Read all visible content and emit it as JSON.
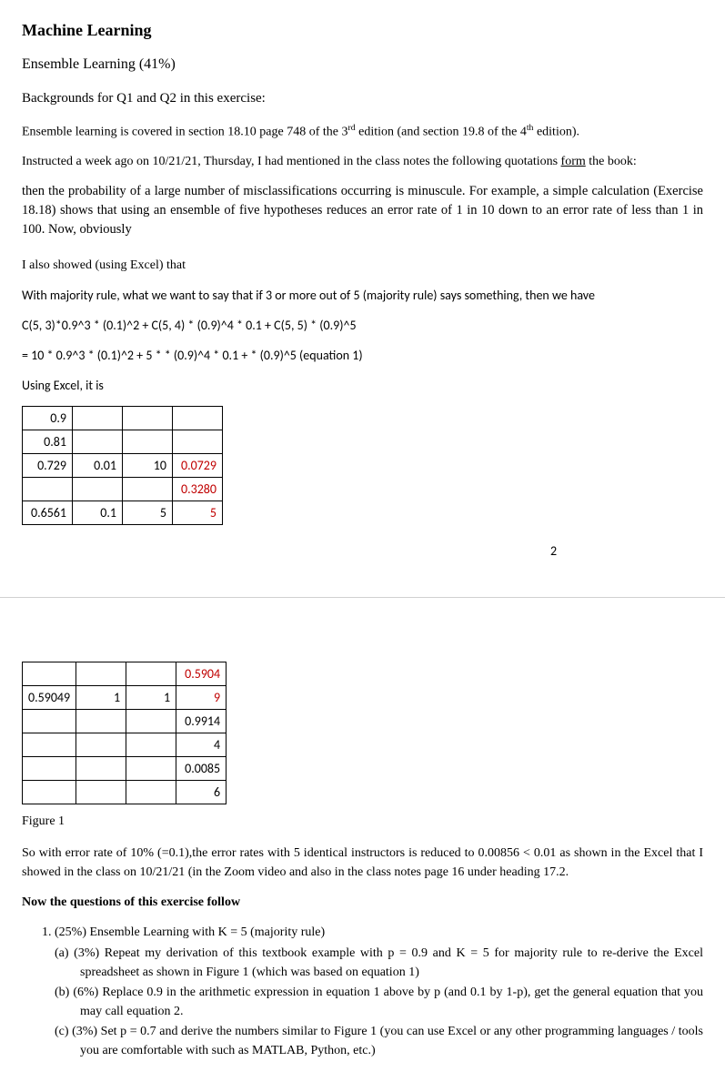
{
  "title": "Machine Learning",
  "subtitle": "Ensemble Learning (41%)",
  "background_heading": "Backgrounds for Q1 and Q2 in this exercise:",
  "p1_pre": "Ensemble learning is covered in section 18.10 page 748 of the 3",
  "p1_sup1": "rd",
  "p1_mid": " edition (and section 19.8 of the 4",
  "p1_sup2": "th",
  "p1_post": " edition).",
  "p2_pre": "Instructed a week ago on 10/21/21, Thursday, I had mentioned in the class notes the following quotations ",
  "p2_u": "form",
  "p2_post": " the book:",
  "quote": "then the probability of a large number of misclassifications occurring is minuscule. For example, a simple calculation (Exercise 18.18) shows that using an ensemble of five hypotheses reduces an error rate of 1 in 10 down to an error rate of less than 1 in 100. Now, obviously",
  "p3": "I also showed (using Excel) that",
  "p4": "With majority rule, what we want to say that if 3 or more out of 5 (majority rule) says something, then we have",
  "eq_line1": "C(5, 3)*0.9^3 * (0.1)^2 + C(5, 4) * (0.9)^4 * 0.1 + C(5, 5) * (0.9)^5",
  "eq_line2": "= 10 * 0.9^3 * (0.1)^2 + 5 * * (0.9)^4 * 0.1 + * (0.9)^5   (equation 1)",
  "p5": "Using Excel, it is",
  "table1": {
    "r1": {
      "c1": "0.9",
      "c2": "",
      "c3": "",
      "c4": ""
    },
    "r2": {
      "c1": "0.81",
      "c2": "",
      "c3": "",
      "c4": ""
    },
    "r3": {
      "c1": "0.729",
      "c2": "0.01",
      "c3": "10",
      "c4": "0.0729"
    },
    "r4": {
      "c1": "",
      "c2": "",
      "c3": "",
      "c4": "0.3280"
    },
    "r5": {
      "c1": "0.6561",
      "c2": "0.1",
      "c3": "5",
      "c4": "5"
    }
  },
  "page_number": "2",
  "table2": {
    "r1": {
      "c1": "",
      "c2": "",
      "c3": "",
      "c4": "0.5904"
    },
    "r2": {
      "c1": "0.59049",
      "c2": "1",
      "c3": "1",
      "c4": "9"
    },
    "r3": {
      "c1": "",
      "c2": "",
      "c3": "",
      "c4": "0.9914"
    },
    "r4": {
      "c1": "",
      "c2": "",
      "c3": "",
      "c4": "4"
    },
    "r5": {
      "c1": "",
      "c2": "",
      "c3": "",
      "c4": "0.0085"
    },
    "r6": {
      "c1": "",
      "c2": "",
      "c3": "",
      "c4": "6"
    }
  },
  "fig_caption": "Figure 1",
  "p6": "So with error rate of 10% (=0.1),the error rates with 5 identical instructors is reduced to 0.00856 < 0.01 as shown in the Excel that I showed in the class on 10/21/21 (in the Zoom video and also in the class notes page 16 under heading 17.2.",
  "exercise_heading": "Now the questions of this exercise follow",
  "q1_main": "(25%) Ensemble Learning with K = 5 (majority rule)",
  "q1a": "(3%) Repeat my derivation of this textbook example with p = 0.9 and K = 5 for majority rule to re-derive the Excel spreadsheet as shown in Figure 1 (which was based on equation 1)",
  "q1b": "(6%) Replace 0.9 in the arithmetic expression in equation 1 above by p (and 0.1 by 1-p), get the general equation that you may call equation 2.",
  "q1c": "(3%) Set p = 0.7 and derive the numbers similar to Figure 1 (you can use Excel or any other programming languages / tools you are comfortable with such as MATLAB, Python, etc.)"
}
